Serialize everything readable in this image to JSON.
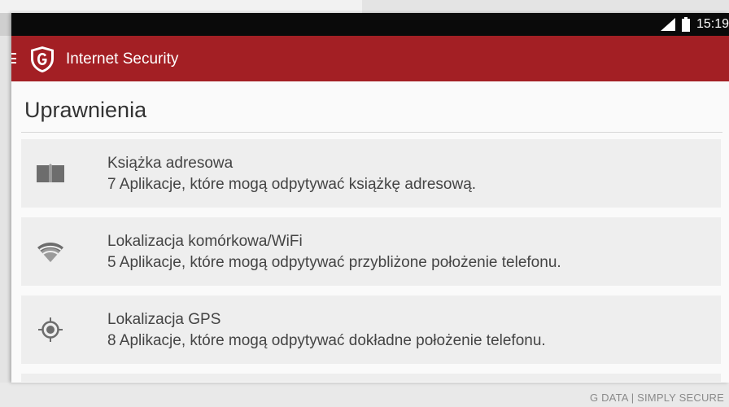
{
  "status": {
    "time": "15:19"
  },
  "app": {
    "title": "Internet Security"
  },
  "page": {
    "title": "Uprawnienia"
  },
  "permissions": [
    {
      "icon": "book-icon",
      "title": "Książka adresowa",
      "desc": "7 Aplikacje, które mogą odpytywać książkę adresową."
    },
    {
      "icon": "wifi-icon",
      "title": "Lokalizacja komórkowa/WiFi",
      "desc": "5 Aplikacje, które mogą odpytywać przybliżone położenie telefonu."
    },
    {
      "icon": "gps-icon",
      "title": "Lokalizacja GPS",
      "desc": "8 Aplikacje, które mogą odpytywać dokładne położenie telefonu."
    }
  ],
  "footer": {
    "text": "G DATA | SIMPLY SECURE"
  },
  "colors": {
    "appbar": "#a31f24",
    "statusbar": "#0a0a0a",
    "card": "#eeeeee",
    "icon": "#6d6d6d"
  }
}
